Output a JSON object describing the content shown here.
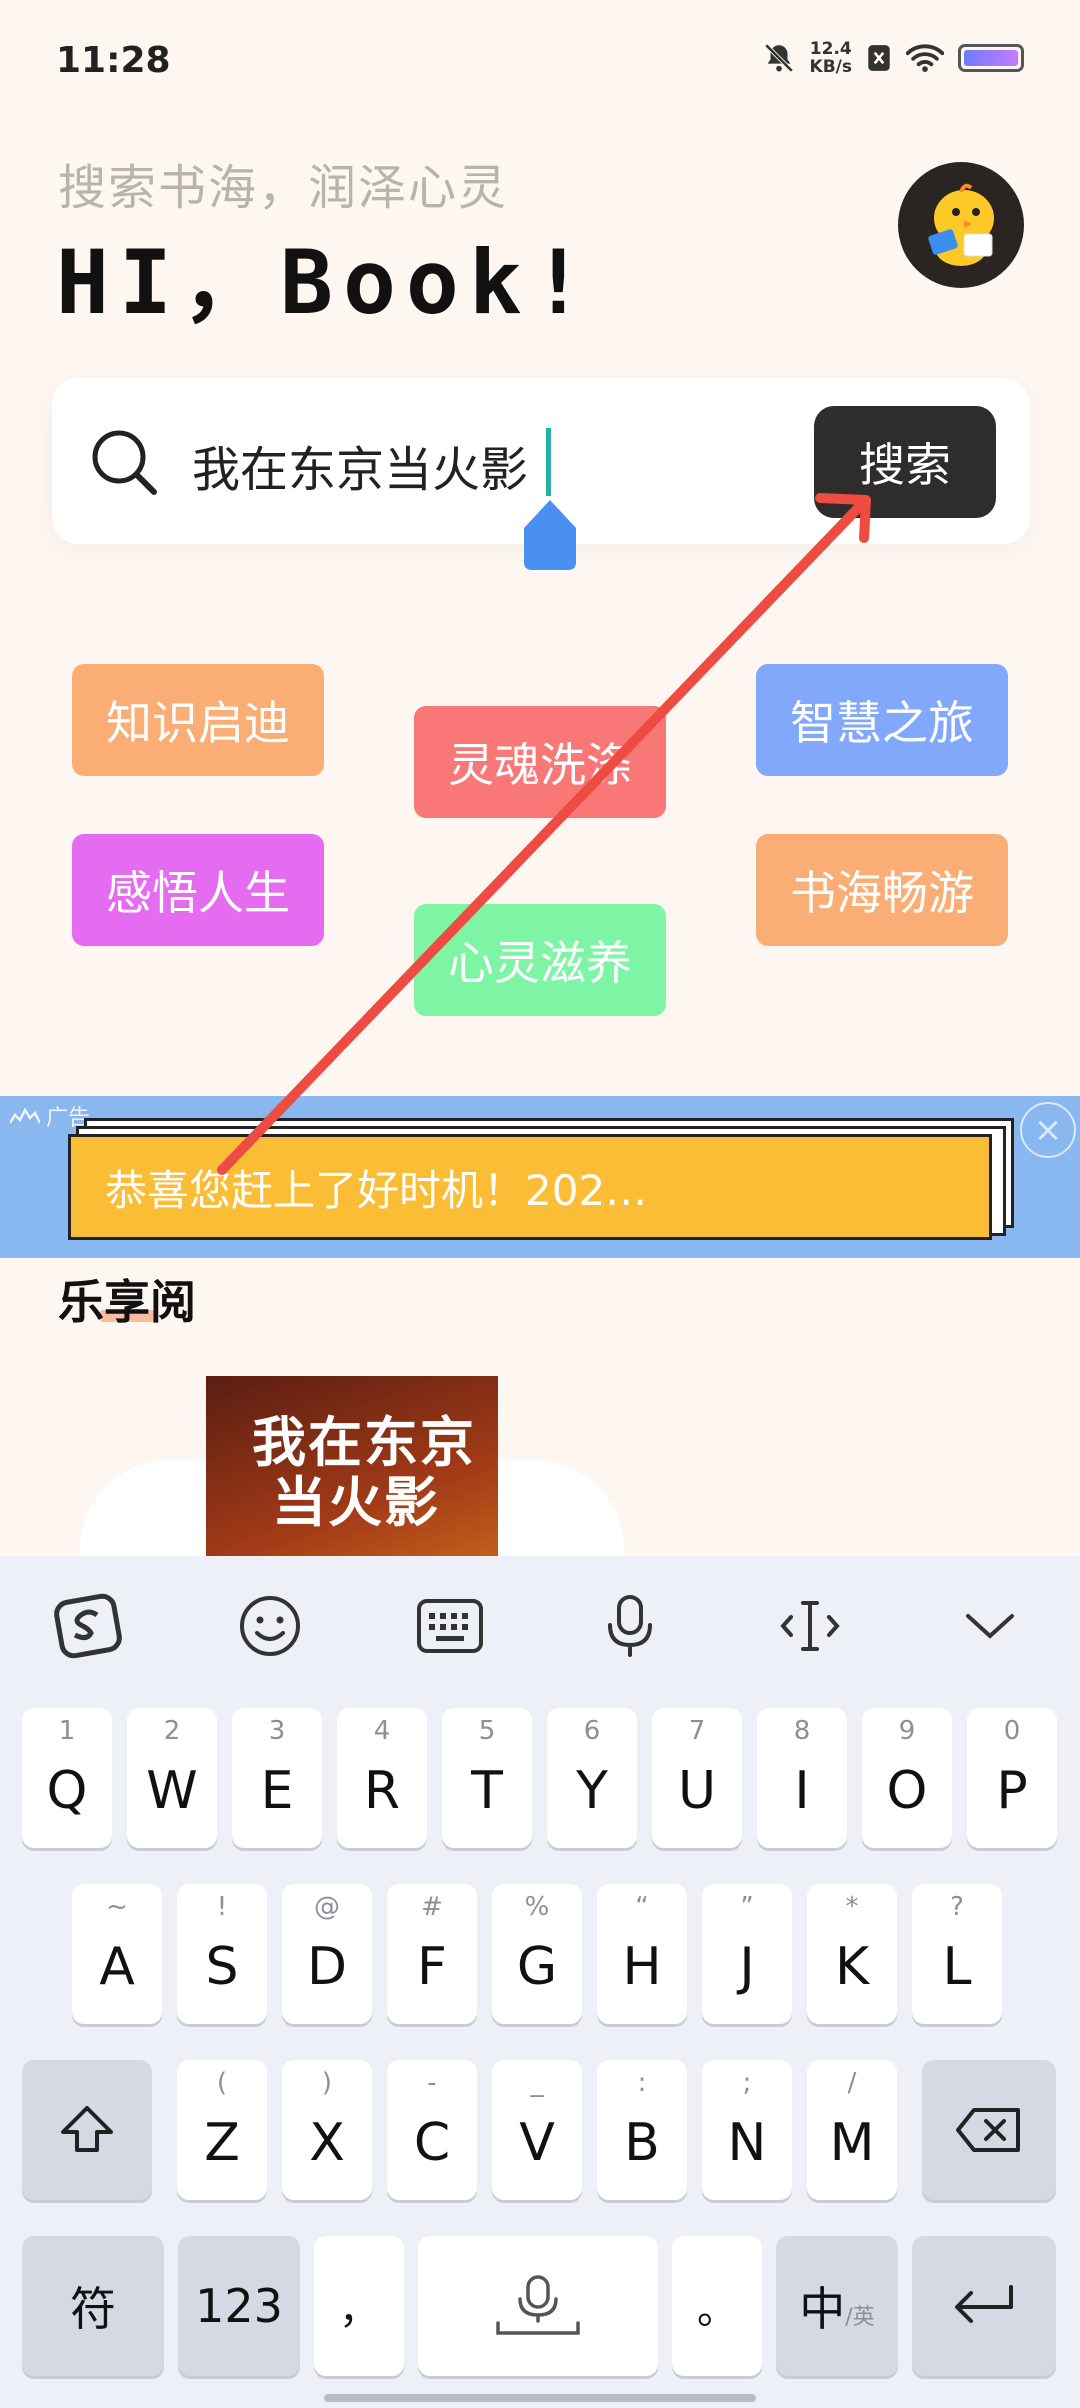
{
  "status_bar": {
    "time": "11:28",
    "net_speed_value": "12.4",
    "net_speed_unit": "KB/s"
  },
  "header": {
    "subtitle": "搜索书海，润泽心灵",
    "title": "HI，Book!"
  },
  "search": {
    "query": "我在东京当火影",
    "button_label": "搜索"
  },
  "tags": [
    {
      "label": "知识启迪",
      "color": "#fbad76"
    },
    {
      "label": "灵魂洗涤",
      "color": "#f97877"
    },
    {
      "label": "智慧之旅",
      "color": "#82a8fb"
    },
    {
      "label": "感悟人生",
      "color": "#e56cf1"
    },
    {
      "label": "心灵滋养",
      "color": "#7ef5a5"
    },
    {
      "label": "书海畅游",
      "color": "#fbad76"
    }
  ],
  "ad": {
    "label": "广告",
    "text": "恭喜您赶上了好时机！202…"
  },
  "section": {
    "title": "乐享阅"
  },
  "book": {
    "title_line1": "我在东京",
    "title_line2": "当火影"
  },
  "keyboard": {
    "row1": [
      {
        "hint": "1",
        "key": "Q"
      },
      {
        "hint": "2",
        "key": "W"
      },
      {
        "hint": "3",
        "key": "E"
      },
      {
        "hint": "4",
        "key": "R"
      },
      {
        "hint": "5",
        "key": "T"
      },
      {
        "hint": "6",
        "key": "Y"
      },
      {
        "hint": "7",
        "key": "U"
      },
      {
        "hint": "8",
        "key": "I"
      },
      {
        "hint": "9",
        "key": "O"
      },
      {
        "hint": "0",
        "key": "P"
      }
    ],
    "row2": [
      {
        "hint": "~",
        "key": "A"
      },
      {
        "hint": "!",
        "key": "S"
      },
      {
        "hint": "@",
        "key": "D"
      },
      {
        "hint": "#",
        "key": "F"
      },
      {
        "hint": "%",
        "key": "G"
      },
      {
        "hint": "“",
        "key": "H"
      },
      {
        "hint": "”",
        "key": "J"
      },
      {
        "hint": "*",
        "key": "K"
      },
      {
        "hint": "?",
        "key": "L"
      }
    ],
    "row3": [
      {
        "hint": "(",
        "key": "Z"
      },
      {
        "hint": ")",
        "key": "X"
      },
      {
        "hint": "-",
        "key": "C"
      },
      {
        "hint": "_",
        "key": "V"
      },
      {
        "hint": ":",
        "key": "B"
      },
      {
        "hint": ";",
        "key": "N"
      },
      {
        "hint": "/",
        "key": "M"
      }
    ],
    "symbols_key": "符",
    "numbers_key": "123",
    "comma_key": "，",
    "period_key": "。",
    "lang_key_main": "中",
    "lang_key_sub": "/英"
  }
}
